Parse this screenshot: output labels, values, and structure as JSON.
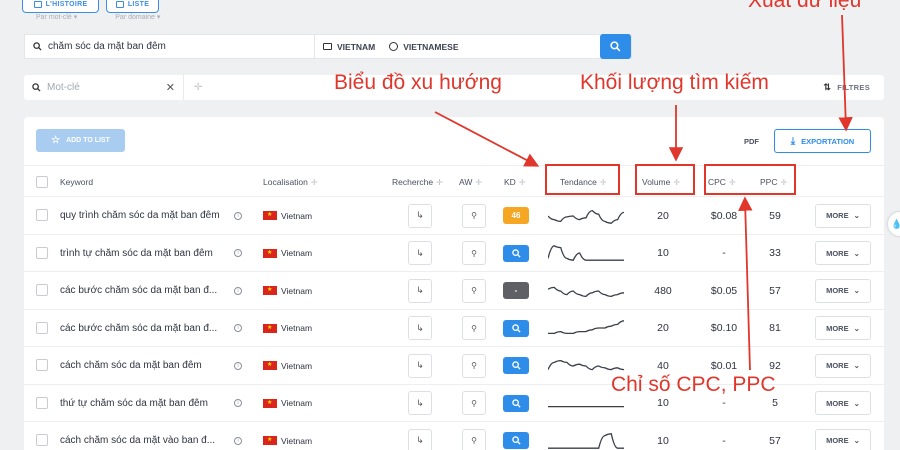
{
  "top_buttons": [
    {
      "label": "L'HISTOIRE"
    },
    {
      "label": "LISTE"
    }
  ],
  "tabs": [
    "Par mot-clé",
    "Par domaine"
  ],
  "search": {
    "keyword": "chăm sóc da mặt ban đêm",
    "country": "VIETNAM",
    "language": "VIETNAMESE"
  },
  "filter": {
    "placeholder": "Mot-clé",
    "filters_label": "FILTRES"
  },
  "toolbar": {
    "add_to_list": "ADD TO LIST",
    "pdf": "PDF",
    "export": "EXPORTATION"
  },
  "headers": {
    "keyword": "Keyword",
    "localisation": "Localisation",
    "recherche": "Recherche",
    "aw": "AW",
    "kd": "KD",
    "tendance": "Tendance",
    "volume": "Volume",
    "cpc": "CPC",
    "ppc": "PPC"
  },
  "rows": [
    {
      "keyword": "quy trình chăm sóc da mặt ban đêm",
      "location": "Vietnam",
      "kd": "46",
      "kd_color": "#f5a623",
      "volume": "20",
      "cpc": "$0.08",
      "ppc": "59",
      "more": "MORE",
      "trend": [
        0.5,
        0.3,
        0.2,
        0.45,
        0.5,
        0.3,
        0.4,
        0.8,
        0.6,
        0.2,
        0.1,
        0.3,
        0.7
      ]
    },
    {
      "keyword": "trình tự chăm sóc da mặt ban đêm",
      "location": "Vietnam",
      "kd": "search",
      "kd_color": "#2e8de8",
      "volume": "10",
      "cpc": "-",
      "ppc": "33",
      "more": "MORE",
      "trend": [
        0.2,
        0.9,
        0.8,
        0.2,
        0.1,
        0.5,
        0.1,
        0.1,
        0.1,
        0.1,
        0.1,
        0.1,
        0.1
      ]
    },
    {
      "keyword": "các bước chăm sóc da mặt ban đ...",
      "location": "Vietnam",
      "kd": "-",
      "kd_color": "#5f6066",
      "volume": "480",
      "cpc": "$0.05",
      "ppc": "57",
      "more": "MORE",
      "trend": [
        0.6,
        0.7,
        0.5,
        0.3,
        0.5,
        0.3,
        0.2,
        0.4,
        0.5,
        0.3,
        0.2,
        0.3,
        0.4
      ]
    },
    {
      "keyword": "các bước chăm sóc da mặt ban đ...",
      "location": "Vietnam",
      "kd": "search",
      "kd_color": "#2e8de8",
      "volume": "20",
      "cpc": "$0.10",
      "ppc": "81",
      "more": "MORE",
      "trend": [
        0.2,
        0.2,
        0.3,
        0.2,
        0.2,
        0.3,
        0.3,
        0.4,
        0.5,
        0.5,
        0.6,
        0.7,
        0.9
      ]
    },
    {
      "keyword": "cách chăm sóc da mặt ban đêm",
      "location": "Vietnam",
      "kd": "search",
      "kd_color": "#2e8de8",
      "volume": "40",
      "cpc": "$0.01",
      "ppc": "92",
      "more": "MORE",
      "trend": [
        0.3,
        0.7,
        0.8,
        0.7,
        0.5,
        0.6,
        0.5,
        0.3,
        0.5,
        0.4,
        0.3,
        0.4,
        0.3
      ]
    },
    {
      "keyword": "thứ tự chăm sóc da mặt ban đêm",
      "location": "Vietnam",
      "kd": "search",
      "kd_color": "#2e8de8",
      "volume": "10",
      "cpc": "-",
      "ppc": "5",
      "more": "MORE",
      "trend": [
        0.3,
        0.3,
        0.3,
        0.3,
        0.3,
        0.3,
        0.3,
        0.3,
        0.3,
        0.3,
        0.3,
        0.3,
        0.3
      ]
    },
    {
      "keyword": "cách chăm sóc da mặt vào ban đ...",
      "location": "Vietnam",
      "kd": "search",
      "kd_color": "#2e8de8",
      "volume": "10",
      "cpc": "-",
      "ppc": "57",
      "more": "MORE",
      "trend": [
        0.1,
        0.1,
        0.1,
        0.1,
        0.1,
        0.1,
        0.1,
        0.1,
        0.1,
        0.8,
        0.9,
        0.1,
        0.1
      ]
    }
  ],
  "annotations": {
    "trend": "Biểu đồ xu hướng",
    "volume": "Khối lượng tìm kiếm",
    "export": "Xuất dữ liệu",
    "cpc": "Chỉ số CPC, PPC"
  },
  "colors": {
    "accent": "#2e8de8",
    "annotation": "#e0362c"
  }
}
